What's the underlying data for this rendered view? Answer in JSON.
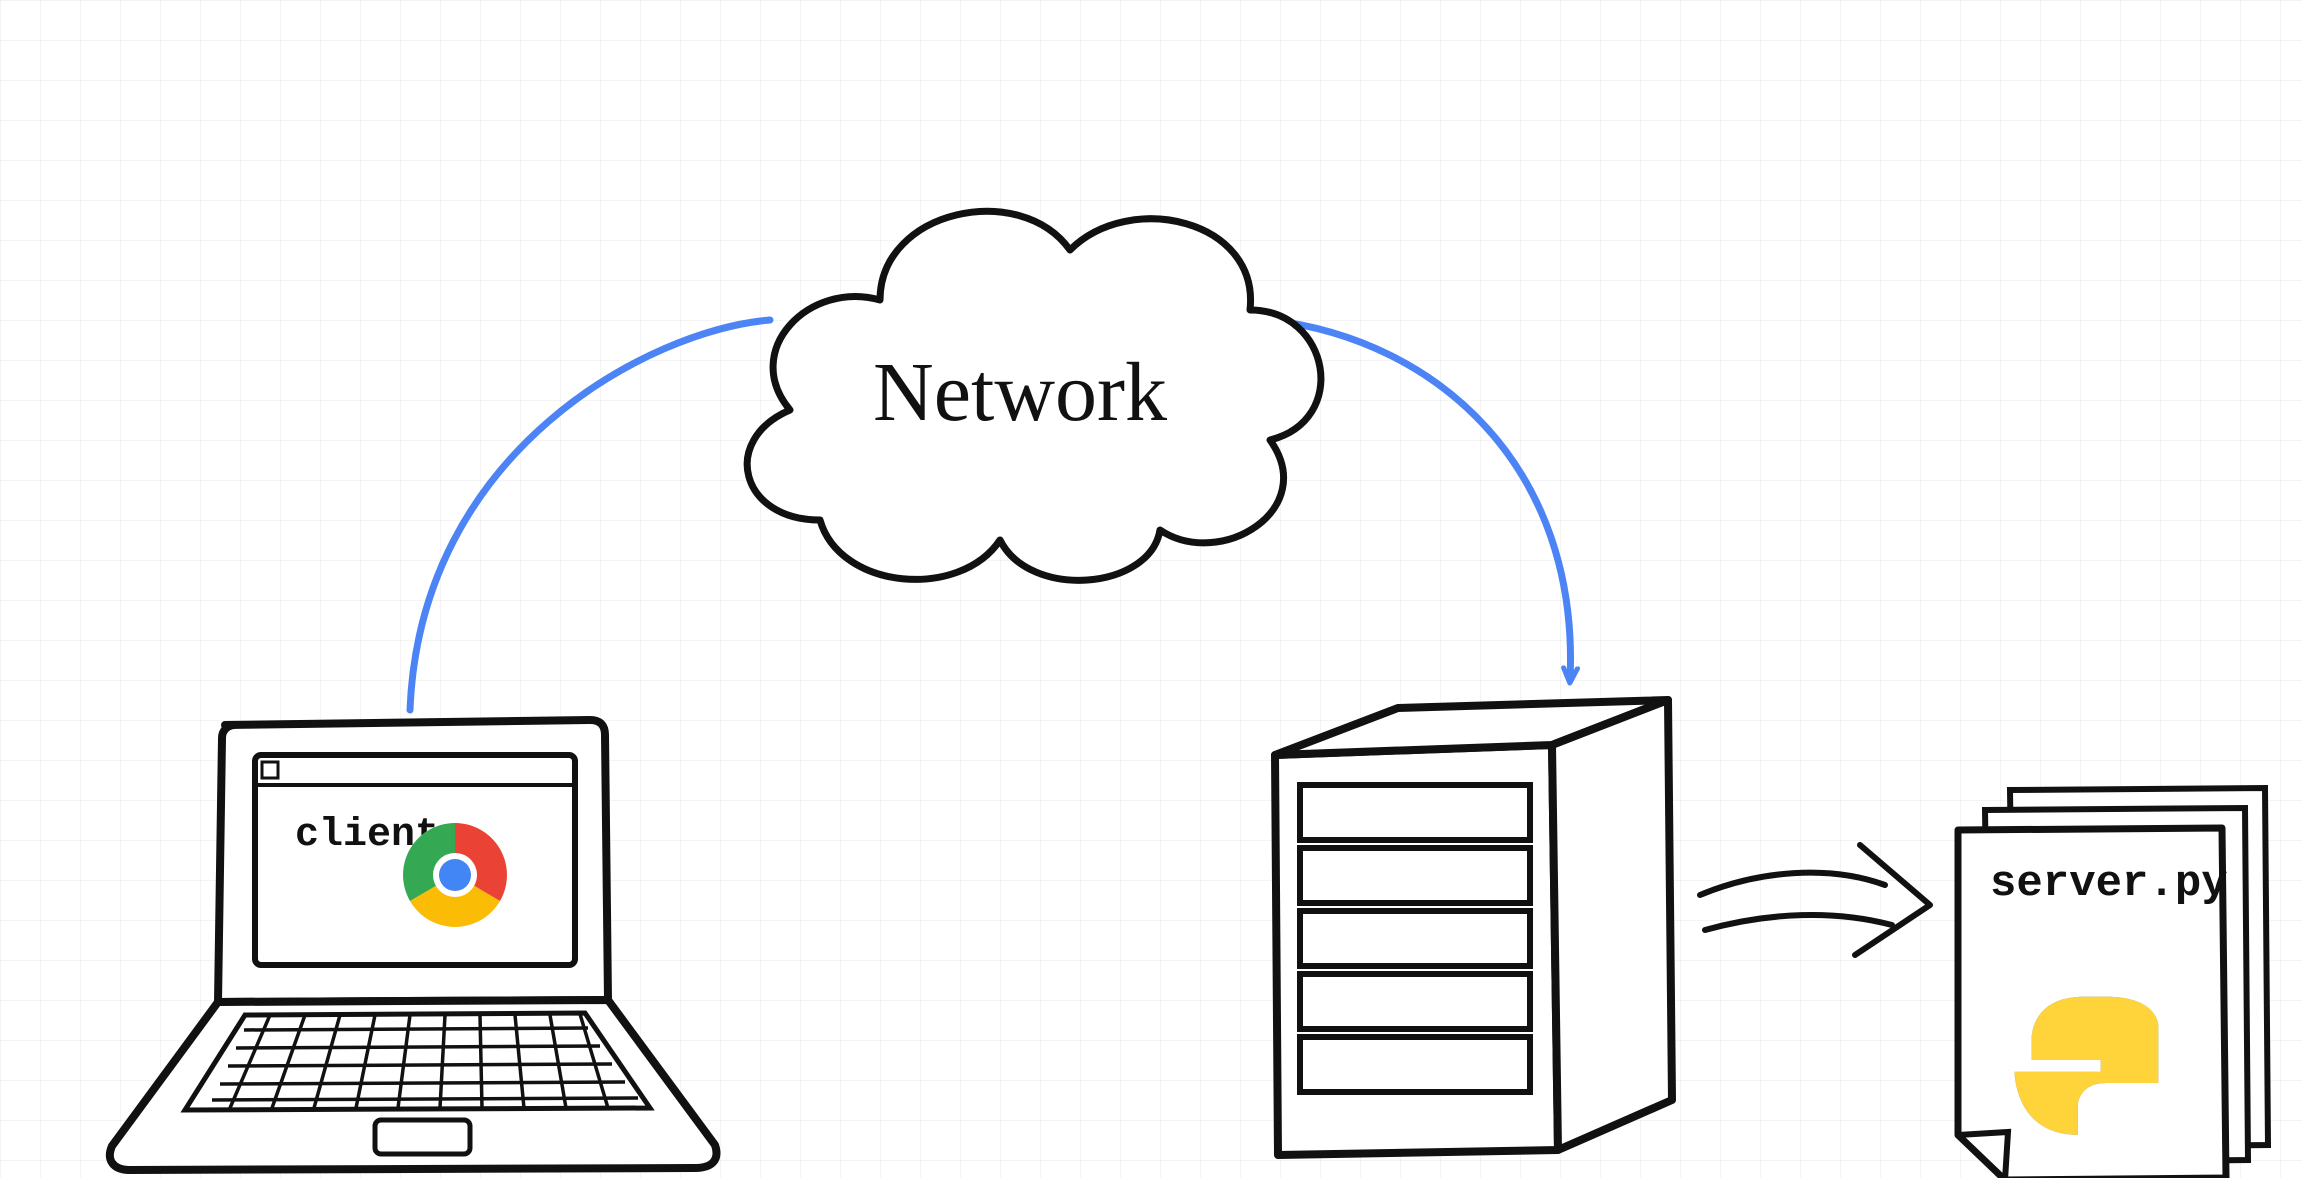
{
  "diagram": {
    "cloud_label": "Network",
    "client_label": "client",
    "server_file_label": "server.py",
    "arrow_color": "#4C84F5",
    "ink_color": "#111111",
    "chrome_colors": {
      "red": "#EA4335",
      "yellow": "#FBBC05",
      "green": "#34A853",
      "blue": "#4285F4"
    },
    "python_colors": {
      "blue": "#3776AB",
      "yellow": "#FFD43B"
    }
  },
  "nodes": [
    {
      "id": "client-laptop",
      "type": "laptop",
      "label_key": "diagram.client_label",
      "icon": "chrome"
    },
    {
      "id": "network-cloud",
      "type": "cloud",
      "label_key": "diagram.cloud_label"
    },
    {
      "id": "server-tower",
      "type": "server"
    },
    {
      "id": "server-file",
      "type": "file-stack",
      "label_key": "diagram.server_file_label",
      "icon": "python"
    }
  ],
  "edges": [
    {
      "from": "client-laptop",
      "through": "network-cloud",
      "to": "server-tower",
      "style": "curve",
      "color_key": "diagram.arrow_color"
    },
    {
      "from": "server-tower",
      "to": "server-file",
      "style": "straight-short",
      "color_key": "diagram.ink_color"
    }
  ]
}
